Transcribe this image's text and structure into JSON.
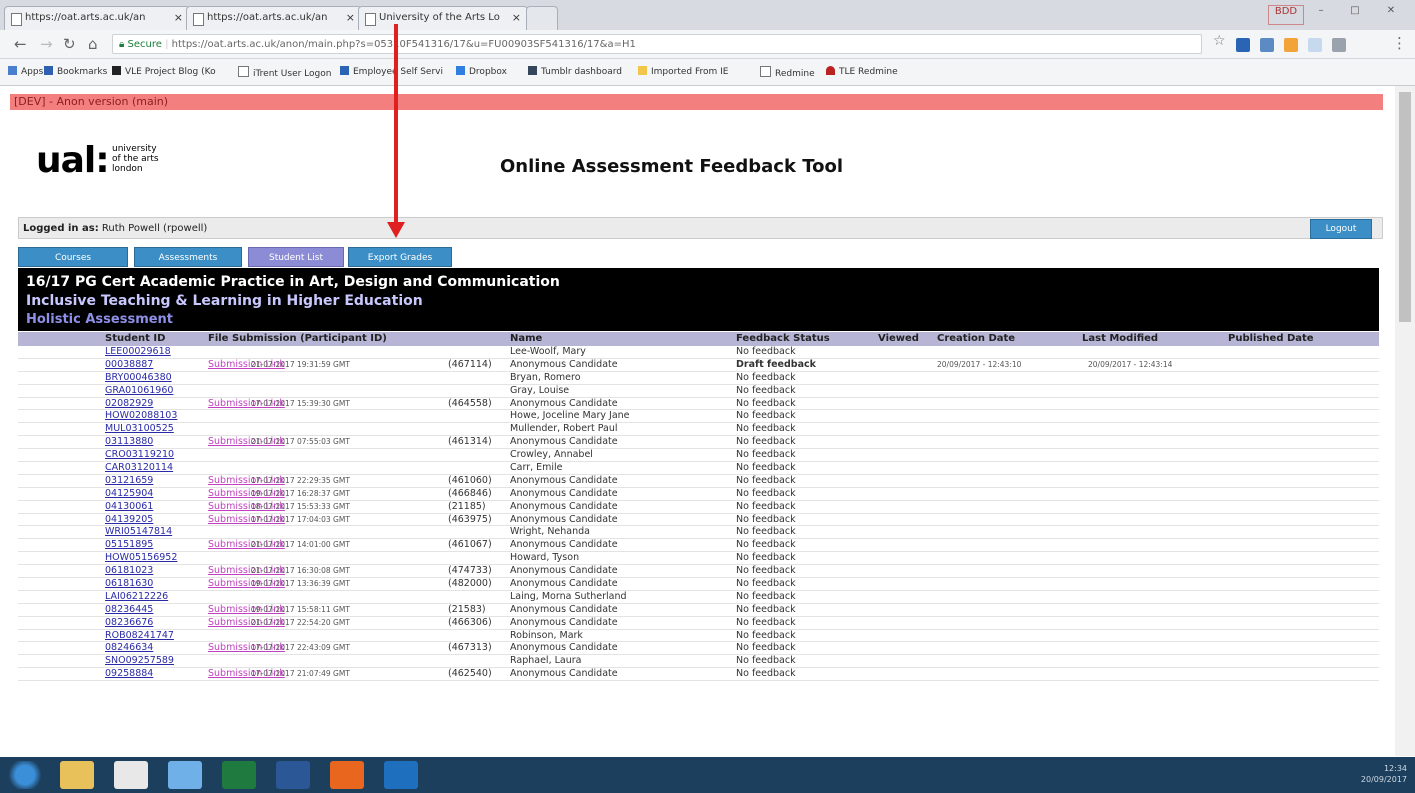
{
  "browser": {
    "tabs": [
      {
        "label": "https://oat.arts.ac.uk/an"
      },
      {
        "label": "https://oat.arts.ac.uk/an"
      },
      {
        "label": "University of the Arts Lo"
      }
    ],
    "window_controls": [
      "BDD",
      "–",
      "□",
      "✕"
    ],
    "secure_label": "Secure",
    "url": "https://oat.arts.ac.uk/anon/main.php?s=05310F541316/17&u=FU00903SF541316/17&a=H1",
    "bookmarks": [
      "Apps",
      "Bookmarks",
      "VLE Project Blog (Ko",
      "iTrent User Logon",
      "Employee Self Servi",
      "Dropbox",
      "Tumblr dashboard",
      "Imported From IE",
      "Redmine",
      "TLE Redmine"
    ]
  },
  "page": {
    "dev_banner": "[DEV] - Anon version (main)",
    "logo": {
      "mark": "ual:",
      "line1": "university",
      "line2": "of the arts",
      "line3": "london"
    },
    "title": "Online Assessment Feedback Tool",
    "login": {
      "label": "Logged in as:",
      "user": "Ruth Powell (rpowell)",
      "logout": "Logout"
    },
    "nav_tabs": [
      "Courses",
      "Assessments",
      "Student List",
      "Export Grades"
    ],
    "course": "16/17 PG Cert Academic Practice in Art, Design and Communication",
    "unit": "Inclusive Teaching & Learning in Higher Education",
    "assessment": "Holistic Assessment",
    "columns": [
      "Student ID",
      "File Submission (Participant ID)",
      "Name",
      "Feedback Status",
      "Viewed",
      "Creation Date",
      "Last Modified",
      "Published Date"
    ],
    "rows": [
      {
        "id": "LEE00029618",
        "link": "",
        "time": "",
        "pid": "",
        "name": "Lee-Woolf, Mary",
        "status": "No feedback",
        "created": "",
        "modified": ""
      },
      {
        "id": "00038887",
        "link": "Submission Link",
        "time": "21-07-2017 19:31:59 GMT",
        "pid": "(467114)",
        "name": "Anonymous Candidate",
        "status": "Draft feedback",
        "created": "20/09/2017 - 12:43:10",
        "modified": "20/09/2017 - 12:43:14"
      },
      {
        "id": "BRY00046380",
        "link": "",
        "time": "",
        "pid": "",
        "name": "Bryan, Romero",
        "status": "No feedback",
        "created": "",
        "modified": ""
      },
      {
        "id": "GRA01061960",
        "link": "",
        "time": "",
        "pid": "",
        "name": "Gray, Louise",
        "status": "No feedback",
        "created": "",
        "modified": ""
      },
      {
        "id": "02082929",
        "link": "Submission Link",
        "time": "17-07-2017 15:39:30 GMT",
        "pid": "(464558)",
        "name": "Anonymous Candidate",
        "status": "No feedback",
        "created": "",
        "modified": ""
      },
      {
        "id": "HOW02088103",
        "link": "",
        "time": "",
        "pid": "",
        "name": "Howe, Joceline Mary Jane",
        "status": "No feedback",
        "created": "",
        "modified": ""
      },
      {
        "id": "MUL03100525",
        "link": "",
        "time": "",
        "pid": "",
        "name": "Mullender, Robert Paul",
        "status": "No feedback",
        "created": "",
        "modified": ""
      },
      {
        "id": "03113880",
        "link": "Submission Link",
        "time": "21-07-2017 07:55:03 GMT",
        "pid": "(461314)",
        "name": "Anonymous Candidate",
        "status": "No feedback",
        "created": "",
        "modified": ""
      },
      {
        "id": "CRO03119210",
        "link": "",
        "time": "",
        "pid": "",
        "name": "Crowley, Annabel",
        "status": "No feedback",
        "created": "",
        "modified": ""
      },
      {
        "id": "CAR03120114",
        "link": "",
        "time": "",
        "pid": "",
        "name": "Carr, Emile",
        "status": "No feedback",
        "created": "",
        "modified": ""
      },
      {
        "id": "03121659",
        "link": "Submission Link",
        "time": "17-07-2017 22:29:35 GMT",
        "pid": "(461060)",
        "name": "Anonymous Candidate",
        "status": "No feedback",
        "created": "",
        "modified": ""
      },
      {
        "id": "04125904",
        "link": "Submission Link",
        "time": "19-07-2017 16:28:37 GMT",
        "pid": "(466846)",
        "name": "Anonymous Candidate",
        "status": "No feedback",
        "created": "",
        "modified": ""
      },
      {
        "id": "04130061",
        "link": "Submission Link",
        "time": "18-07-2017 15:53:33 GMT",
        "pid": "(21185)",
        "name": "Anonymous Candidate",
        "status": "No feedback",
        "created": "",
        "modified": ""
      },
      {
        "id": "04139205",
        "link": "Submission Link",
        "time": "17-07-2017 17:04:03 GMT",
        "pid": "(463975)",
        "name": "Anonymous Candidate",
        "status": "No feedback",
        "created": "",
        "modified": ""
      },
      {
        "id": "WRI05147814",
        "link": "",
        "time": "",
        "pid": "",
        "name": "Wright, Nehanda",
        "status": "No feedback",
        "created": "",
        "modified": ""
      },
      {
        "id": "05151895",
        "link": "Submission Link",
        "time": "21-07-2017 14:01:00 GMT",
        "pid": "(461067)",
        "name": "Anonymous Candidate",
        "status": "No feedback",
        "created": "",
        "modified": ""
      },
      {
        "id": "HOW05156952",
        "link": "",
        "time": "",
        "pid": "",
        "name": "Howard, Tyson",
        "status": "No feedback",
        "created": "",
        "modified": ""
      },
      {
        "id": "06181023",
        "link": "Submission Link",
        "time": "21-07-2017 16:30:08 GMT",
        "pid": "(474733)",
        "name": "Anonymous Candidate",
        "status": "No feedback",
        "created": "",
        "modified": ""
      },
      {
        "id": "06181630",
        "link": "Submission Link",
        "time": "19-07-2017 13:36:39 GMT",
        "pid": "(482000)",
        "name": "Anonymous Candidate",
        "status": "No feedback",
        "created": "",
        "modified": ""
      },
      {
        "id": "LAI06212226",
        "link": "",
        "time": "",
        "pid": "",
        "name": "Laing, Morna Sutherland",
        "status": "No feedback",
        "created": "",
        "modified": ""
      },
      {
        "id": "08236445",
        "link": "Submission Link",
        "time": "19-07-2017 15:58:11 GMT",
        "pid": "(21583)",
        "name": "Anonymous Candidate",
        "status": "No feedback",
        "created": "",
        "modified": ""
      },
      {
        "id": "08236676",
        "link": "Submission Link",
        "time": "21-07-2017 22:54:20 GMT",
        "pid": "(466306)",
        "name": "Anonymous Candidate",
        "status": "No feedback",
        "created": "",
        "modified": ""
      },
      {
        "id": "ROB08241747",
        "link": "",
        "time": "",
        "pid": "",
        "name": "Robinson, Mark",
        "status": "No feedback",
        "created": "",
        "modified": ""
      },
      {
        "id": "08246634",
        "link": "Submission Link",
        "time": "17-07-2017 22:43:09 GMT",
        "pid": "(467313)",
        "name": "Anonymous Candidate",
        "status": "No feedback",
        "created": "",
        "modified": ""
      },
      {
        "id": "SNO09257589",
        "link": "",
        "time": "",
        "pid": "",
        "name": "Raphael, Laura",
        "status": "No feedback",
        "created": "",
        "modified": ""
      },
      {
        "id": "09258884",
        "link": "Submission Link",
        "time": "17-07-2017 21:07:49 GMT",
        "pid": "(462540)",
        "name": "Anonymous Candidate",
        "status": "No feedback",
        "created": "",
        "modified": ""
      }
    ]
  },
  "taskbar": {
    "time": "12:34",
    "date": "20/09/2017"
  },
  "colors": {
    "accent_blue": "#3b8fc6",
    "tab_active": "#8c8cd6",
    "link": "#2a2aa8",
    "submission_link": "#c040c0",
    "dev_banner": "#f47f7f",
    "annotation_arrow": "#e02020"
  }
}
